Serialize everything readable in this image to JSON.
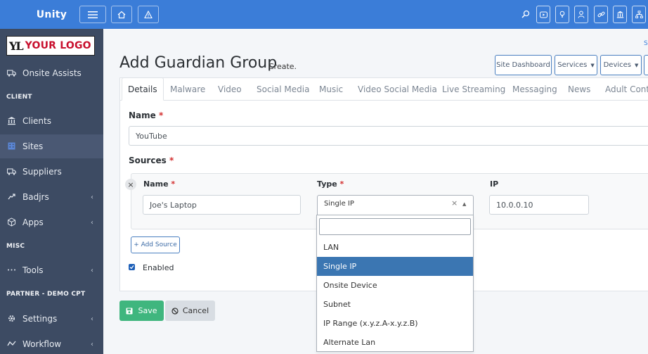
{
  "app": {
    "title": "Unity"
  },
  "sidebar": {
    "logo_mark": "YL",
    "logo_text": "YOUR LOGO",
    "items": [
      {
        "label": "Onsite Assists"
      },
      {
        "label": "Clients"
      },
      {
        "label": "Sites"
      },
      {
        "label": "Suppliers"
      },
      {
        "label": "Badjrs",
        "chevron": "‹"
      },
      {
        "label": "Apps",
        "chevron": "‹"
      },
      {
        "label": "Tools",
        "chevron": "‹"
      },
      {
        "label": "Settings",
        "chevron": "‹"
      },
      {
        "label": "Workflow",
        "chevron": "‹"
      }
    ],
    "sections": {
      "client": "CLIENT",
      "misc": "MISC",
      "partner": "PARTNER - DEMO CPT"
    }
  },
  "header": {
    "title": "Add Guardian Group",
    "subtitle": "Create.",
    "crumb": "S",
    "buttons": {
      "site_dashboard": "Site Dashboard",
      "services": "Services",
      "devices": "Devices"
    }
  },
  "tabs": [
    "Details",
    "Malware",
    "Video",
    "Social Media",
    "Music",
    "Video Social Media",
    "Live Streaming",
    "Messaging",
    "News",
    "Adult Content"
  ],
  "form": {
    "name_label": "Name",
    "name_value": "YouTube",
    "sources_label": "Sources",
    "source": {
      "name_label": "Name",
      "name_value": "Joe's Laptop",
      "type_label": "Type",
      "type_value": "Single IP",
      "clear": "×",
      "ip_label": "IP",
      "ip_value": "10.0.0.10"
    },
    "required_mark": "*",
    "add_source": "+ Add Source",
    "enabled_label": "Enabled",
    "save": "Save",
    "cancel": "Cancel"
  },
  "dropdown": {
    "options": [
      "LAN",
      "Single IP",
      "Onsite Device",
      "Subnet",
      "IP Range (x.y.z.A-x.y.z.B)",
      "Alternate Lan"
    ],
    "selected": "Single IP"
  },
  "colors": {
    "topbar": "#3b7dd8",
    "sidebar": "#3d4b63",
    "save": "#3fb67e",
    "selected_option": "#3b76b2"
  }
}
